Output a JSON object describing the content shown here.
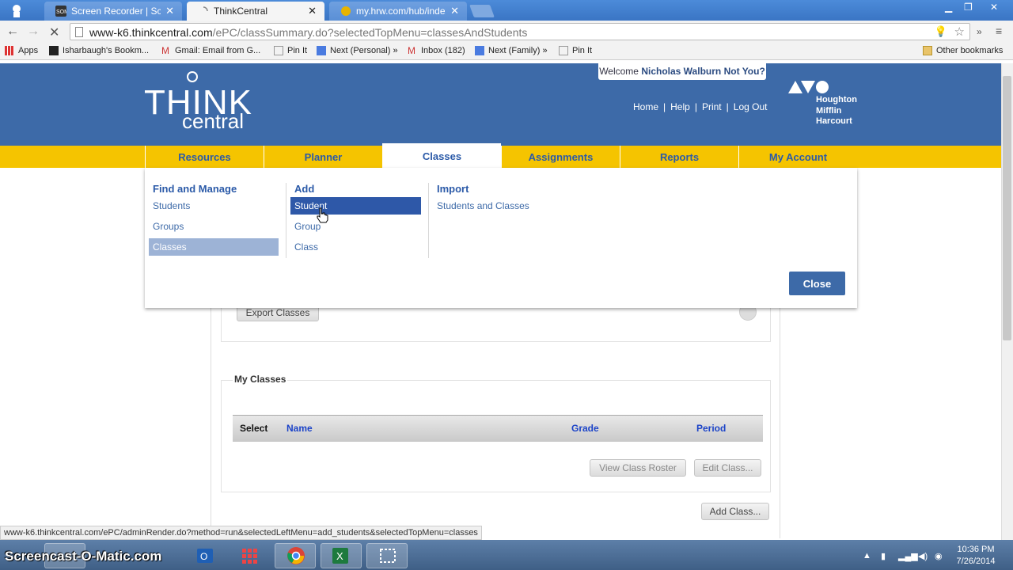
{
  "browser": {
    "tabs": [
      {
        "label": "Screen Recorder | Screenc",
        "active": false
      },
      {
        "label": "ThinkCentral",
        "active": true
      },
      {
        "label": "my.hrw.com/hub/index.js",
        "active": false
      }
    ],
    "url_host": "www-k6.thinkcentral.com",
    "url_path": "/ePC/classSummary.do?selectedTopMenu=classesAndStudents",
    "bookmarks": [
      {
        "label": "Apps"
      },
      {
        "label": "Isharbaugh's Bookm..."
      },
      {
        "label": "Gmail: Email from G..."
      },
      {
        "label": "Pin It"
      },
      {
        "label": "Next (Personal) »"
      },
      {
        "label": "Inbox (182)"
      },
      {
        "label": "Next (Family) »"
      },
      {
        "label": "Pin It"
      }
    ],
    "other_bookmarks": "Other bookmarks",
    "status_url": "www-k6.thinkcentral.com/ePC/adminRender.do?method=run&selectedLeftMenu=add_students&selectedTopMenu=classes"
  },
  "header": {
    "logo_think": "THINK",
    "logo_central": "central",
    "welcome_prefix": "Welcome",
    "user_name": "Nicholas Walburn",
    "not_you": "Not You?",
    "links": [
      "Home",
      "Help",
      "Print",
      "Log Out"
    ],
    "publisher_lines": [
      "Houghton",
      "Mifflin",
      "Harcourt"
    ]
  },
  "nav": {
    "items": [
      "Resources",
      "Planner",
      "Classes",
      "Assignments",
      "Reports",
      "My Account"
    ],
    "active": "Classes"
  },
  "dropdown": {
    "find_manage": {
      "heading": "Find and Manage",
      "items": [
        "Students",
        "Groups",
        "Classes"
      ],
      "selected": "Classes"
    },
    "add": {
      "heading": "Add",
      "items": [
        "Student",
        "Group",
        "Class"
      ],
      "hovered": "Student"
    },
    "import": {
      "heading": "Import",
      "items": [
        "Students and Classes"
      ]
    },
    "close_label": "Close"
  },
  "content": {
    "export_classes": "Export Classes",
    "my_classes_label": "My Classes",
    "table_headers": [
      "Select",
      "Name",
      "Grade",
      "Period"
    ],
    "view_roster": "View Class Roster",
    "edit_class": "Edit Class...",
    "add_class": "Add Class..."
  },
  "taskbar": {
    "watermark": "Screencast-O-Matic.com",
    "time": "10:36 PM",
    "date": "7/26/2014"
  }
}
